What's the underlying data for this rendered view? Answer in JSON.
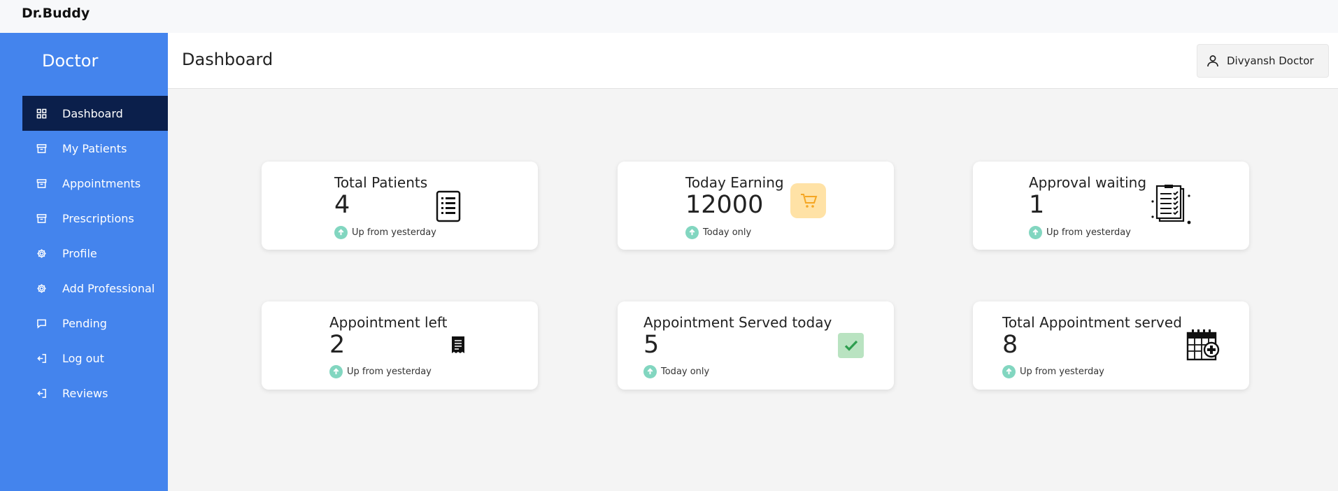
{
  "app": {
    "brand": "Dr.Buddy"
  },
  "sidebar": {
    "title": "Doctor",
    "items": [
      {
        "label": "Dashboard",
        "icon": "grid-icon",
        "active": true
      },
      {
        "label": "My Patients",
        "icon": "archive-icon"
      },
      {
        "label": "Appointments",
        "icon": "archive-icon"
      },
      {
        "label": "Prescriptions",
        "icon": "archive-icon"
      },
      {
        "label": "Profile",
        "icon": "gear-icon"
      },
      {
        "label": "Add Professional",
        "icon": "gear-icon"
      },
      {
        "label": "Pending",
        "icon": "message-icon"
      },
      {
        "label": "Log out",
        "icon": "logout-icon"
      },
      {
        "label": "Reviews",
        "icon": "logout-icon"
      }
    ]
  },
  "header": {
    "title": "Dashboard",
    "user_name": "Divyansh Doctor"
  },
  "cards": [
    {
      "title": "Total Patients",
      "value": "4",
      "footer": "Up from yesterday",
      "icon": "list-document-icon"
    },
    {
      "title": "Today Earning",
      "value": "12000",
      "footer": "Today only",
      "icon": "cart-icon"
    },
    {
      "title": "Approval waiting",
      "value": "1",
      "footer": "Up from yesterday",
      "icon": "checklist-icon"
    },
    {
      "title": "Appointment left",
      "value": "2",
      "footer": "Up from yesterday",
      "icon": "receipt-icon"
    },
    {
      "title": "Appointment Served today",
      "value": "5",
      "footer": "Today only",
      "icon": "check-icon"
    },
    {
      "title": "Total Appointment served",
      "value": "8",
      "footer": "Up from yesterday",
      "icon": "calendar-plus-icon"
    }
  ],
  "colors": {
    "sidebar": "#4484ed",
    "active_item": "#0b1f4b",
    "up_indicator": "#82d6c0",
    "cart_badge": "#ffe2a6",
    "check_badge": "#b9e3c1"
  }
}
